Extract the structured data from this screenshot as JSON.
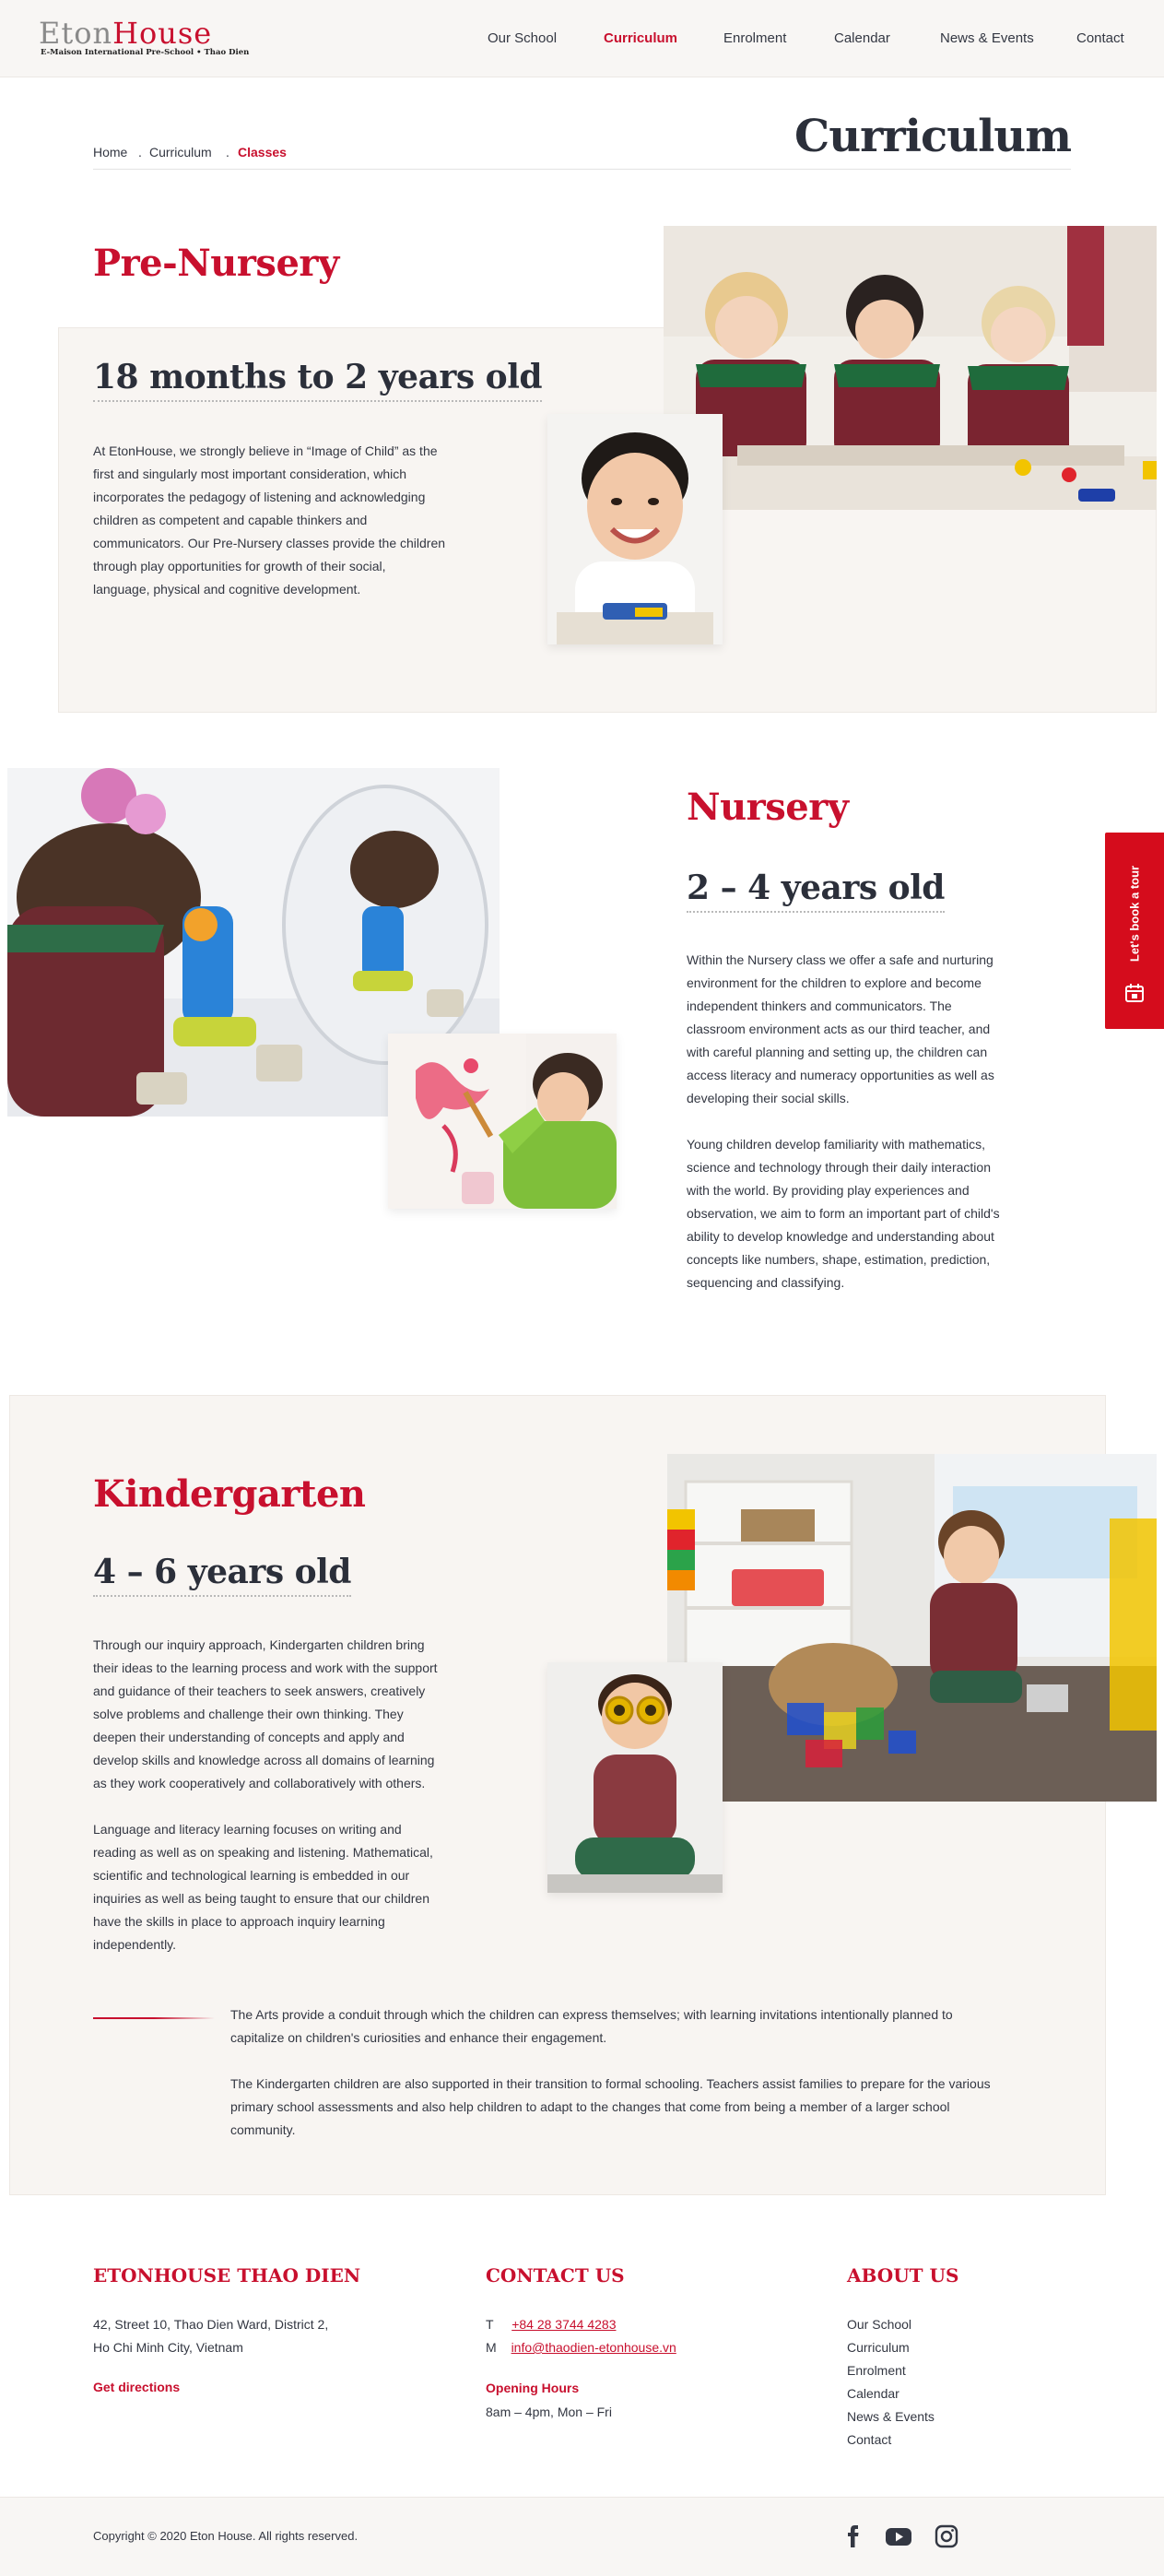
{
  "header": {
    "logo_eton": "Eton",
    "logo_house": "House",
    "logo_tagline": "E-Maison International Pre-School • Thao Dien",
    "nav": [
      "Our School",
      "Curriculum",
      "Enrolment",
      "Calendar",
      "News & Events",
      "Contact"
    ],
    "active_nav": "Curriculum"
  },
  "breadcrumb": {
    "items": [
      "Home",
      "Curriculum",
      "Classes"
    ],
    "separator": "."
  },
  "page_title": "Curriculum",
  "pre_nursery": {
    "title": "Pre-Nursery",
    "age": "18 months to 2 years old",
    "lines": [
      "At EtonHouse, we strongly believe in “Image of Child” as the",
      "first and singularly most important consideration, which",
      "incorporates the pedagogy of listening and acknowledging",
      "children as competent and capable thinkers and",
      "communicators. Our Pre-Nursery classes provide the children",
      "through play opportunities for growth of their social,",
      "language, physical and cognitive development."
    ]
  },
  "nursery": {
    "title": "Nursery",
    "age": "2 – 4 years old",
    "para1_lines": [
      "Within the Nursery class we offer a safe and nurturing",
      "environment for the children to explore and become",
      "independent thinkers and communicators. The",
      "classroom environment acts as our third teacher, and",
      "with careful planning and setting up, the children can",
      "access literacy and numeracy opportunities as well as",
      "developing their social skills."
    ],
    "para2_lines": [
      "Young children develop familiarity with mathematics,",
      "science and technology through their daily interaction",
      "with the world. By providing play experiences and",
      "observation, we aim to form an important part of child's",
      "ability to develop knowledge and understanding about",
      "concepts like numbers, shape, estimation, prediction,",
      "sequencing and classifying."
    ]
  },
  "kindergarten": {
    "title": "Kindergarten",
    "age": "4 – 6 years old",
    "para1_lines": [
      "Through our inquiry approach, Kindergarten children bring",
      "their ideas to the learning process and work with the support",
      "and guidance of their teachers to seek answers, creatively",
      "solve problems and challenge their own thinking. They",
      "deepen their understanding of concepts and apply and",
      "develop skills and knowledge across all domains of learning",
      "as they work cooperatively and collaboratively with others."
    ],
    "para2_lines": [
      "Language and literacy learning focuses on writing and",
      "reading as well as on speaking and listening. Mathematical,",
      "scientific and technological learning is embedded in our",
      "inquiries as well as being taught to ensure that our children",
      "have the skills in place to approach inquiry learning",
      "independently."
    ],
    "para3_lines": [
      "The Arts provide a conduit through which the children can express themselves; with learning invitations intentionally planned to",
      "capitalize on children's curiosities and enhance their engagement."
    ],
    "para4_lines": [
      "The Kindergarten children are also supported in their transition to formal schooling. Teachers assist families to prepare for the various",
      "primary school assessments and also help children to adapt to the changes that come from being a member of a larger school",
      "community."
    ]
  },
  "side_tab": {
    "label": "Let's book a tour",
    "icon": "calendar-icon",
    "color": "#d50c1c"
  },
  "footer": {
    "school": {
      "heading": "ETONHOUSE THAO DIEN",
      "address_line1": "42, Street 10, Thao Dien Ward, District 2,",
      "address_line2": "Ho Chi Minh City, Vietnam",
      "directions": "Get directions"
    },
    "contact": {
      "heading": "CONTACT US",
      "phone_prefix": "T",
      "phone": "+84 28 3744 4283",
      "mail_prefix": "M",
      "email": "info@thaodien-etonhouse.vn",
      "hours_heading": "Opening Hours",
      "hours": "8am – 4pm, Mon – Fri"
    },
    "about": {
      "heading": "ABOUT US",
      "links": [
        "Our School",
        "Curriculum",
        "Enrolment",
        "Calendar",
        "News & Events",
        "Contact"
      ]
    },
    "copyright": "Copyright © 2020 Eton House. All rights reserved.",
    "social_icons": [
      "facebook-icon",
      "youtube-icon",
      "instagram-icon"
    ]
  },
  "colors": {
    "brand_red": "#c8102e",
    "text_dark": "#333742",
    "beige_bg": "#f8f5f2"
  }
}
